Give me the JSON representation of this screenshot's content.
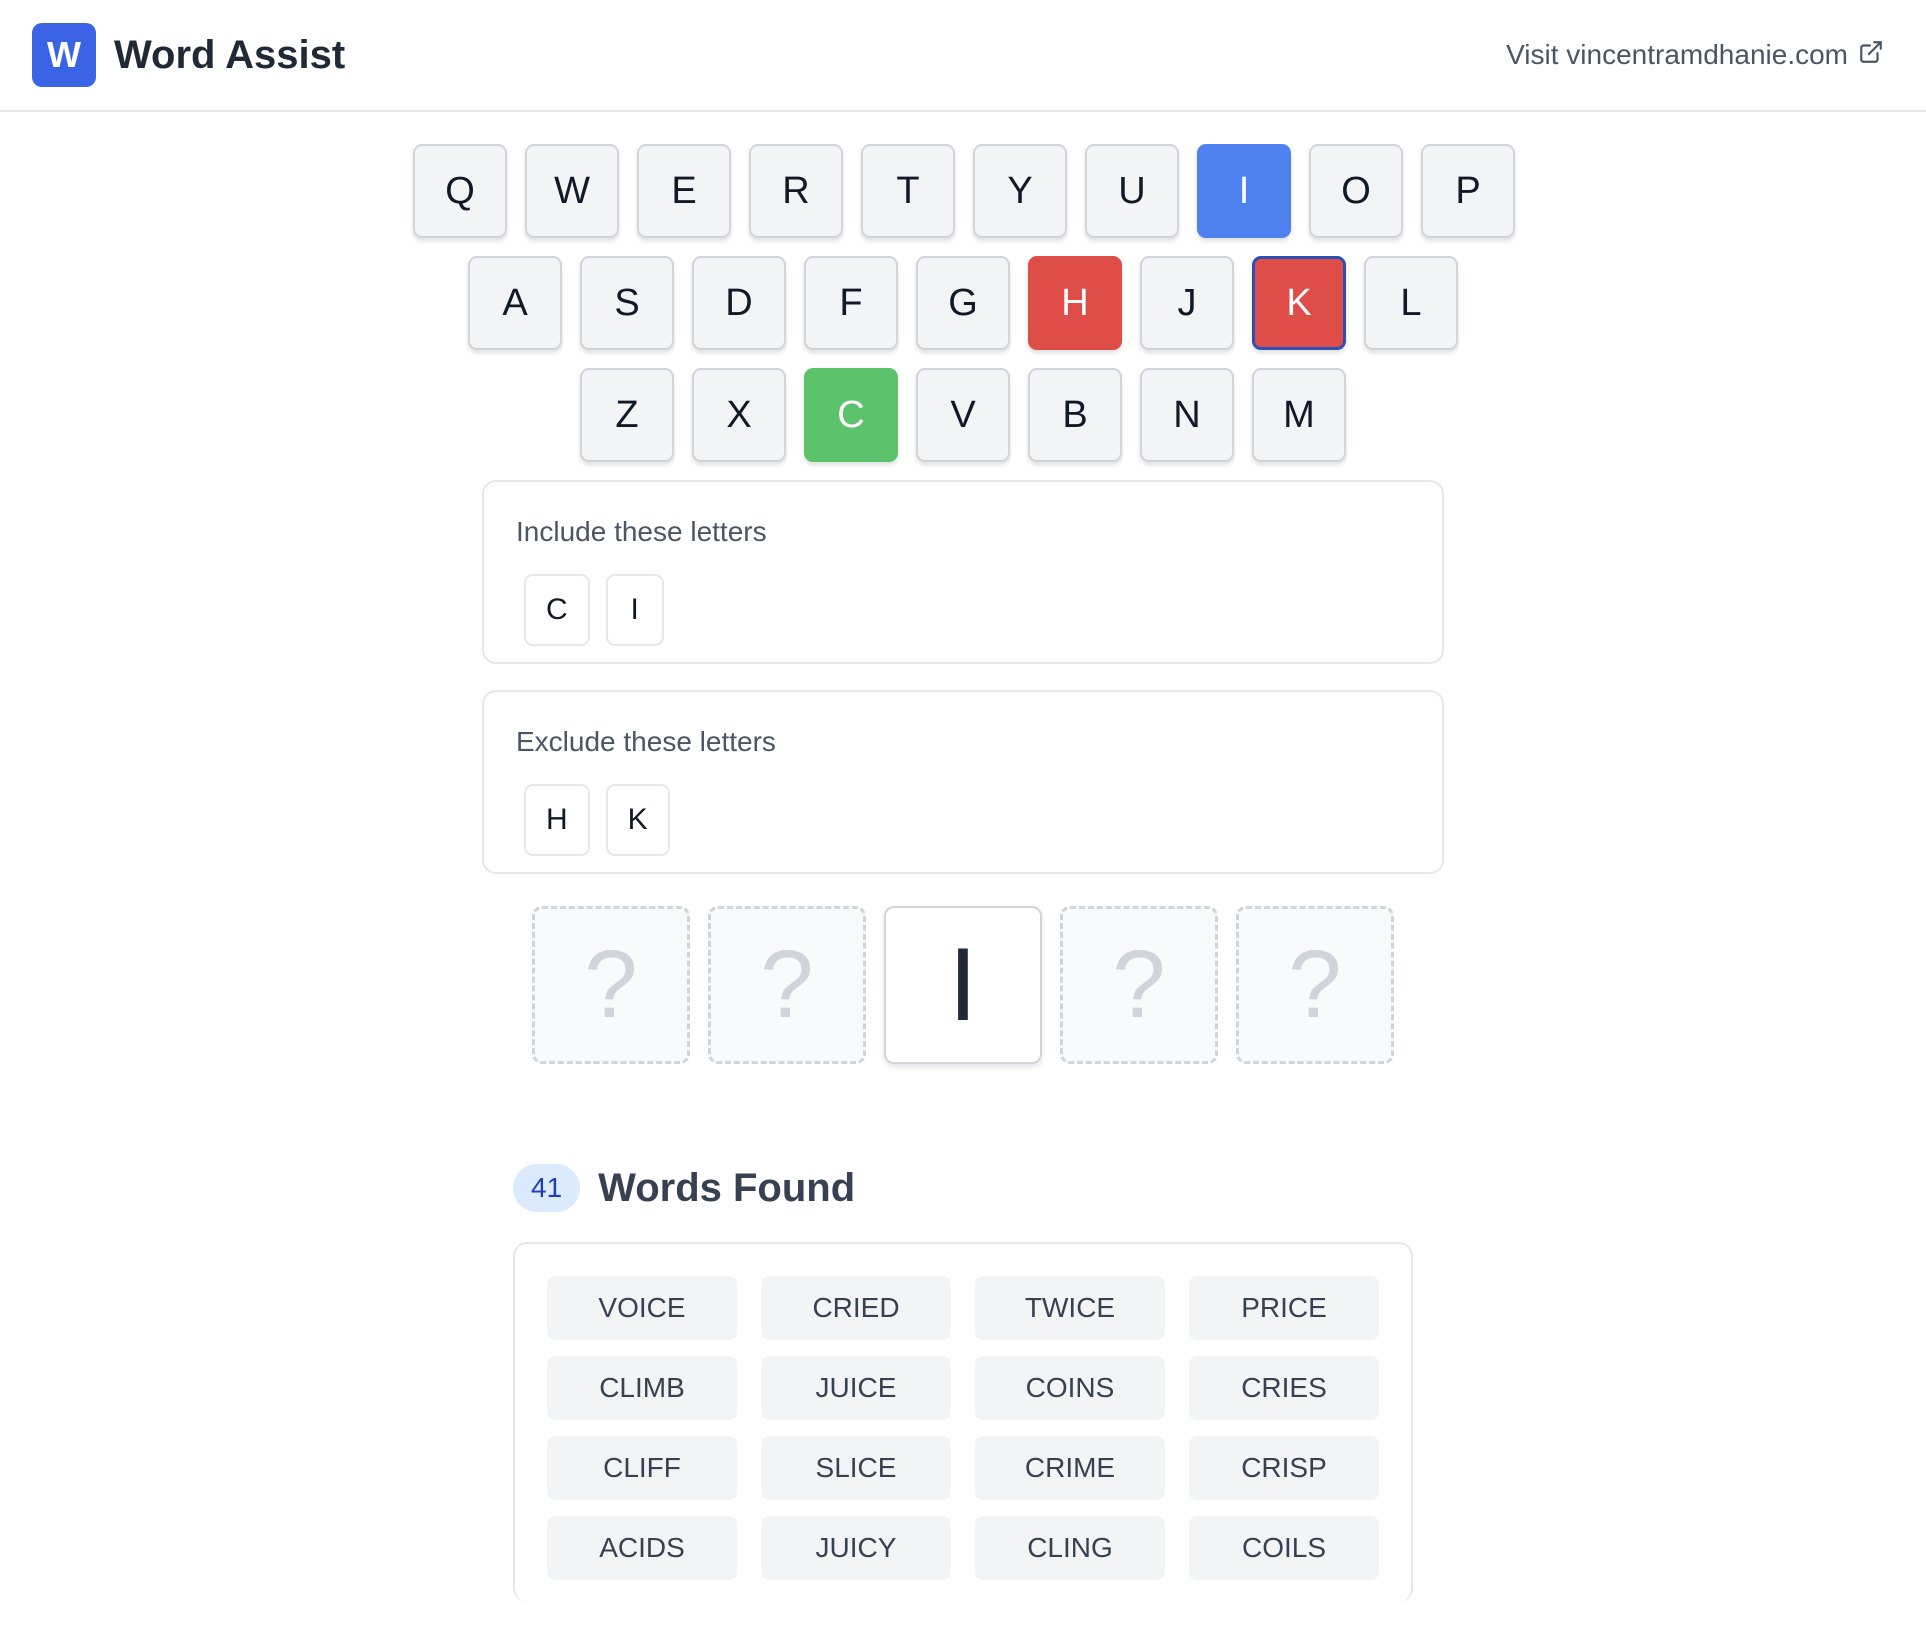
{
  "header": {
    "logo_letter": "W",
    "title": "Word Assist",
    "visit_link": "Visit vincentramdhanie.com"
  },
  "keyboard": {
    "row1": [
      {
        "letter": "Q",
        "state": "default"
      },
      {
        "letter": "W",
        "state": "default"
      },
      {
        "letter": "E",
        "state": "default"
      },
      {
        "letter": "R",
        "state": "default"
      },
      {
        "letter": "T",
        "state": "default"
      },
      {
        "letter": "Y",
        "state": "default"
      },
      {
        "letter": "U",
        "state": "default"
      },
      {
        "letter": "I",
        "state": "included"
      },
      {
        "letter": "O",
        "state": "default"
      },
      {
        "letter": "P",
        "state": "default"
      }
    ],
    "row2": [
      {
        "letter": "A",
        "state": "default"
      },
      {
        "letter": "S",
        "state": "default"
      },
      {
        "letter": "D",
        "state": "default"
      },
      {
        "letter": "F",
        "state": "default"
      },
      {
        "letter": "G",
        "state": "default"
      },
      {
        "letter": "H",
        "state": "excluded"
      },
      {
        "letter": "J",
        "state": "default"
      },
      {
        "letter": "K",
        "state": "excluded-focused"
      },
      {
        "letter": "L",
        "state": "default"
      }
    ],
    "row3": [
      {
        "letter": "Z",
        "state": "default"
      },
      {
        "letter": "X",
        "state": "default"
      },
      {
        "letter": "C",
        "state": "placed"
      },
      {
        "letter": "V",
        "state": "default"
      },
      {
        "letter": "B",
        "state": "default"
      },
      {
        "letter": "N",
        "state": "default"
      },
      {
        "letter": "M",
        "state": "default"
      }
    ]
  },
  "include_panel": {
    "label": "Include these letters",
    "letters": [
      "C",
      "I"
    ]
  },
  "exclude_panel": {
    "label": "Exclude these letters",
    "letters": [
      "H",
      "K"
    ]
  },
  "slots": [
    "?",
    "?",
    "I",
    "?",
    "?"
  ],
  "results": {
    "count": "41",
    "title": "Words Found",
    "words": [
      "VOICE",
      "CRIED",
      "TWICE",
      "PRICE",
      "CLIMB",
      "JUICE",
      "COINS",
      "CRIES",
      "CLIFF",
      "SLICE",
      "CRIME",
      "CRISP",
      "ACIDS",
      "JUICY",
      "CLING",
      "COILS"
    ]
  },
  "colors": {
    "brand": "#3b63e6",
    "included": "#4f82f0",
    "excluded": "#df4d48",
    "placed": "#5cc36c"
  }
}
